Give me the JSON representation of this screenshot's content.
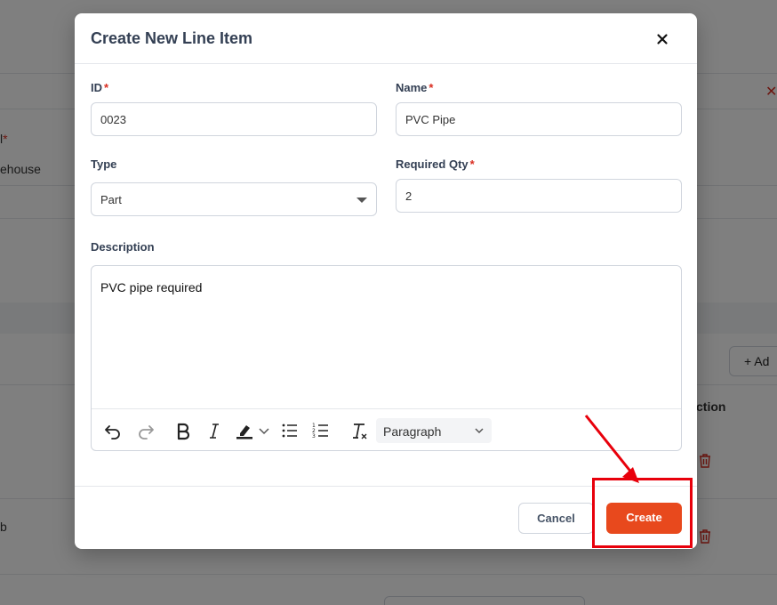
{
  "background": {
    "label_suffix": "*",
    "warehouse_text": "ehouse",
    "add_label": "+ Ad",
    "action_header": "ction",
    "row_text": "b"
  },
  "modal": {
    "title": "Create New Line Item",
    "fields": {
      "id": {
        "label": "ID",
        "value": "0023"
      },
      "name": {
        "label": "Name",
        "value": "PVC Pipe"
      },
      "type": {
        "label": "Type",
        "value": "Part"
      },
      "required_qty": {
        "label": "Required Qty",
        "value": "2"
      },
      "description": {
        "label": "Description",
        "value": "PVC pipe required"
      }
    },
    "required_marker": "*",
    "editor": {
      "block_format": "Paragraph"
    },
    "buttons": {
      "cancel": "Cancel",
      "create": "Create"
    }
  },
  "colors": {
    "accent": "#e8491d",
    "required": "#d92d20",
    "annotation": "#e8000b"
  }
}
